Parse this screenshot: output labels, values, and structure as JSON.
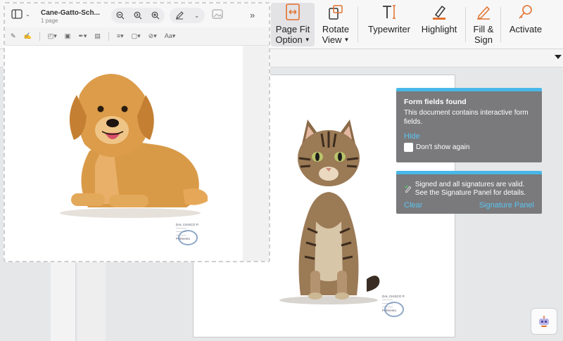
{
  "toolbar": {
    "page_fit": {
      "line1": "Page Fit",
      "line2": "Option",
      "icon": "page-fit-icon"
    },
    "rotate": {
      "line1": "Rotate",
      "line2": "View",
      "icon": "rotate-view-icon"
    },
    "typewriter": {
      "label": "Typewriter",
      "icon": "typewriter-icon"
    },
    "highlight": {
      "label": "Highlight",
      "icon": "highlight-icon"
    },
    "fill_sign": {
      "line1": "Fill &",
      "line2": "Sign",
      "icon": "fill-sign-icon"
    },
    "activate": {
      "label": "Activate",
      "icon": "activate-icon"
    }
  },
  "preview": {
    "title": "Cane-Gatto-Sch...",
    "subtitle": "1 page",
    "stamp_lines": [
      "DAL CHISCO P.",
      "----------",
      "----------",
      "----------",
      "Pelimento"
    ]
  },
  "page_stamp_lines": [
    "DAL CHISCO P.",
    "----------",
    "----------",
    "----------",
    "Pelimento"
  ],
  "notifications": {
    "form": {
      "title": "Form fields found",
      "body": "This document contains interactive form fields.",
      "hide": "Hide",
      "dont_show": "Don't show again"
    },
    "signature": {
      "body": "Signed and all signatures are valid. See the Signature Panel for details.",
      "clear": "Clear",
      "panel": "Signature Panel"
    }
  },
  "colors": {
    "accent": "#49b7e8",
    "link": "#5cc3f0",
    "notification_bg": "#7a7a7c",
    "icon_orange": "#e2712d"
  }
}
